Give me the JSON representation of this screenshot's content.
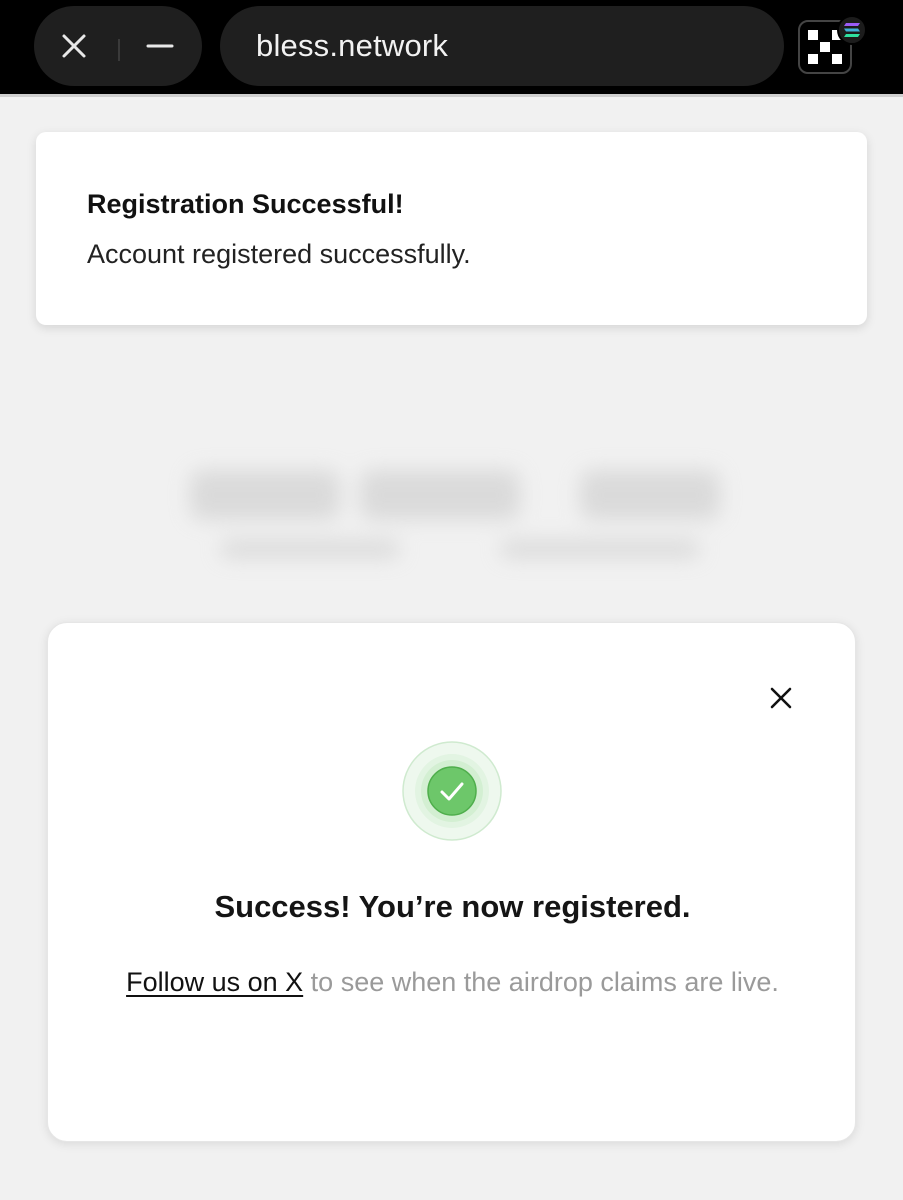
{
  "browser": {
    "url": "bless.network",
    "close_icon": "close-icon",
    "minimize_icon": "minimize-icon",
    "wallet_icon": "okx-wallet-icon",
    "network_badge_icon": "solana-icon"
  },
  "toast": {
    "title": "Registration Successful!",
    "message": "Account registered successfully."
  },
  "modal": {
    "close_icon": "close-icon",
    "status_icon": "check-circle-icon",
    "title": "Success! You’re now registered.",
    "link_text": "Follow us on X",
    "description_rest": " to see when the airdrop claims are live."
  },
  "colors": {
    "success_green": "#6dc76a",
    "topbar": "#000000",
    "link": "#111111",
    "muted_text": "#9a9a9a"
  }
}
